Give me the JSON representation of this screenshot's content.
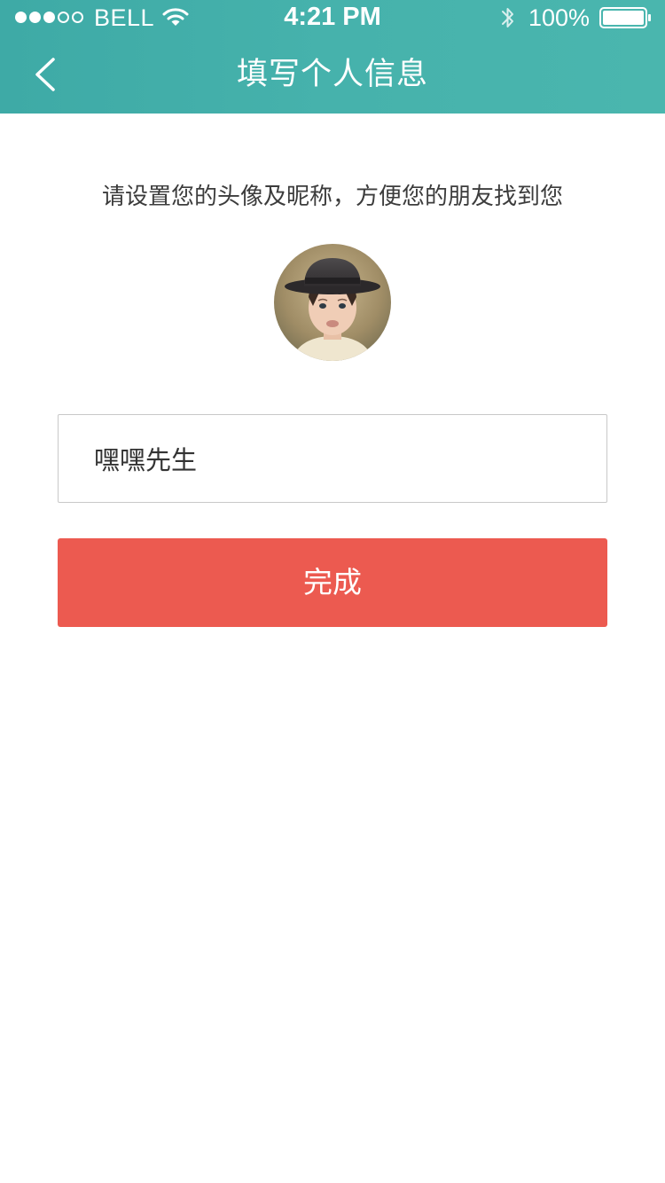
{
  "status_bar": {
    "signal_filled": 3,
    "signal_total": 5,
    "carrier": "BELL",
    "time": "4:21 PM",
    "battery_percent": "100%",
    "battery_level": 1.0,
    "icons": [
      "signal-dots",
      "wifi-icon",
      "bluetooth-icon",
      "battery-icon"
    ]
  },
  "nav": {
    "back_icon": "chevron-left-icon",
    "title": "填写个人信息"
  },
  "content": {
    "prompt": "请设置您的头像及昵称，方便您的朋友找到您",
    "nickname_value": "嘿嘿先生",
    "done_label": "完成"
  },
  "colors": {
    "header": "#46b2ac",
    "primary_button": "#ec5a50",
    "text": "#3c3c3c",
    "input_border": "#c8c8c8"
  }
}
